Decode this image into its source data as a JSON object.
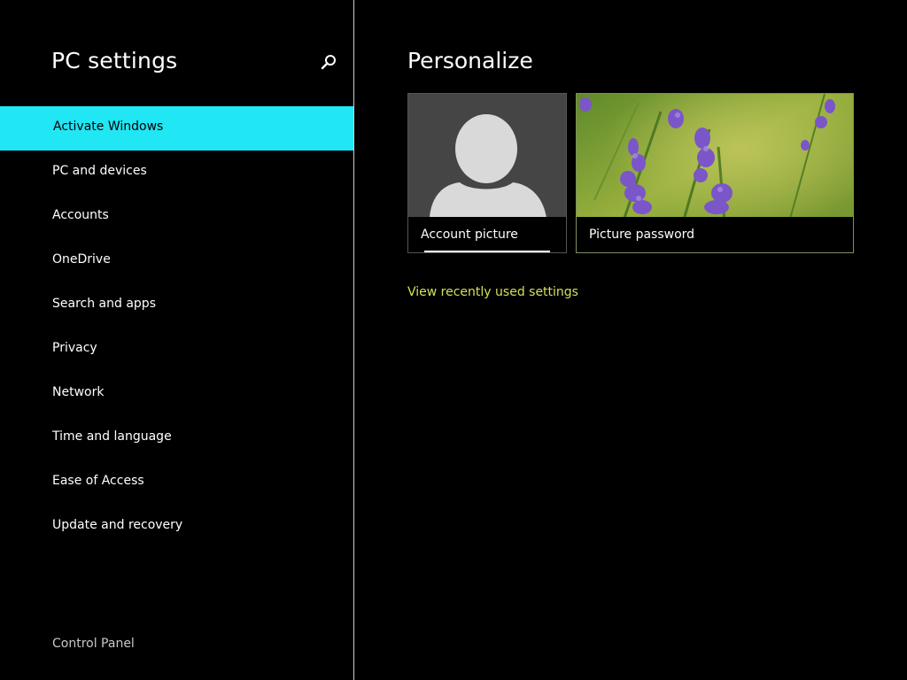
{
  "theme": {
    "accent": "#21e6f3",
    "link": "#d4e157",
    "background": "#000000"
  },
  "sidebar": {
    "title": "PC settings",
    "search_icon": "search-icon",
    "items": [
      {
        "label": "Activate Windows",
        "active": true
      },
      {
        "label": "PC and devices",
        "active": false
      },
      {
        "label": "Accounts",
        "active": false
      },
      {
        "label": "OneDrive",
        "active": false
      },
      {
        "label": "Search and apps",
        "active": false
      },
      {
        "label": "Privacy",
        "active": false
      },
      {
        "label": "Network",
        "active": false
      },
      {
        "label": "Time and language",
        "active": false
      },
      {
        "label": "Ease of Access",
        "active": false
      },
      {
        "label": "Update and recovery",
        "active": false
      }
    ],
    "footer_link": "Control Panel"
  },
  "main": {
    "title": "Personalize",
    "tiles": [
      {
        "label": "Account picture",
        "icon": "user-silhouette-icon"
      },
      {
        "label": "Picture password",
        "icon": "lavender-photo"
      }
    ],
    "recent_link": "View recently used settings"
  }
}
